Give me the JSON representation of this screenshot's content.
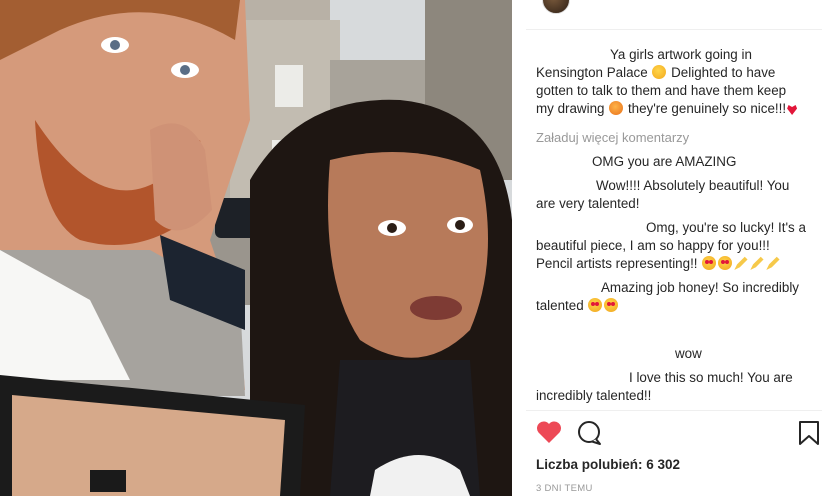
{
  "post": {
    "caption": "Ya girls artwork going in Kensington Palace ",
    "caption_parts": [
      "Ya girls artwork going in Kensington Palace",
      "Delighted to have gotten to talk to them and have them keep my drawing",
      "they're genuinely so nice!!!"
    ],
    "load_more": "Załaduj więcej komentarzy"
  },
  "comments": [
    {
      "text": "OMG you are AMAZING"
    },
    {
      "text": "Wow!!!! Absolutely beautiful! You are very talented!"
    },
    {
      "text": "Omg, you're so lucky! It's a beautiful piece, I am so happy for you!!! Pencil artists representing!!"
    },
    {
      "text": "Amazing job honey! So incredibly talented"
    },
    {
      "text": "wow"
    },
    {
      "text": "I love this so much! You are incredibly talented!!"
    }
  ],
  "likes": {
    "label": "Liczba polubień:",
    "count": "6 302"
  },
  "time_ago": "3 DNI TEMU",
  "icons": {
    "like": "heart-icon",
    "comment": "comment-bubble-icon",
    "save": "bookmark-icon"
  },
  "colors": {
    "like_active": "#ed4956",
    "muted_text": "#999999",
    "text": "#262626",
    "link": "#3897f0"
  }
}
